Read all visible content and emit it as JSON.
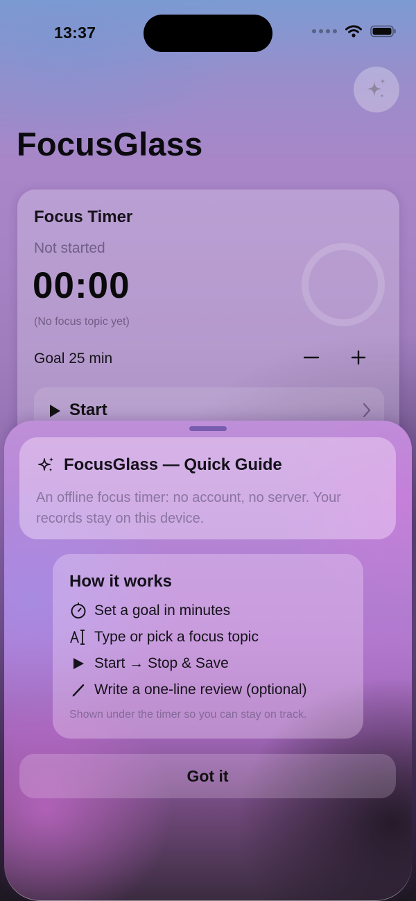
{
  "status_bar": {
    "time": "13:37"
  },
  "app": {
    "title": "FocusGlass"
  },
  "timer_card": {
    "title": "Focus Timer",
    "state": "Not started",
    "clock": "00:00",
    "topic": "(No focus topic yet)",
    "goal": "Goal 25 min",
    "start_label": "Start"
  },
  "guide": {
    "title": "FocusGlass — Quick Guide",
    "description": "An offline focus timer: no account, no server. Your records stay on this device.",
    "how_title": "How it works",
    "steps": [
      {
        "icon": "timer-icon",
        "label": "Set a goal in minutes"
      },
      {
        "icon": "text-cursor-icon",
        "label": "Type or pick a focus topic"
      },
      {
        "icon": "play-icon",
        "label": "Start → Stop & Save"
      },
      {
        "icon": "pencil-icon",
        "label": "Write a one-line review (optional)"
      }
    ],
    "note": "Shown under the timer so you can stay on track.",
    "dismiss_label": "Got it"
  }
}
